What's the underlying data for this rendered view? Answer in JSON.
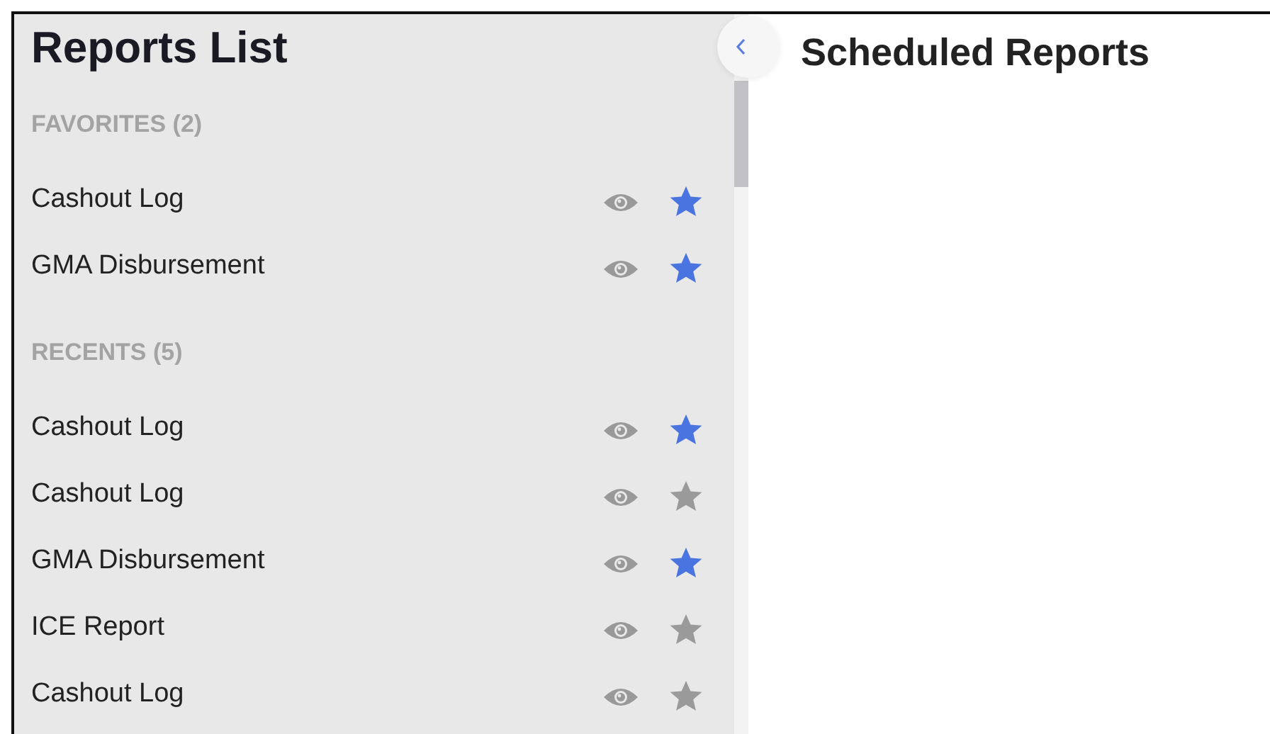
{
  "sidebar": {
    "title": "Reports List",
    "sections": [
      {
        "heading": "FAVORITES (2)",
        "items": [
          {
            "label": "Cashout Log",
            "favorite": true
          },
          {
            "label": "GMA Disbursement",
            "favorite": true
          }
        ]
      },
      {
        "heading": "RECENTS (5)",
        "items": [
          {
            "label": "Cashout Log",
            "favorite": true
          },
          {
            "label": "Cashout Log",
            "favorite": false
          },
          {
            "label": "GMA Disbursement",
            "favorite": true
          },
          {
            "label": "ICE Report",
            "favorite": false
          },
          {
            "label": "Cashout Log",
            "favorite": false
          }
        ]
      }
    ]
  },
  "main": {
    "title": "Scheduled Reports"
  }
}
